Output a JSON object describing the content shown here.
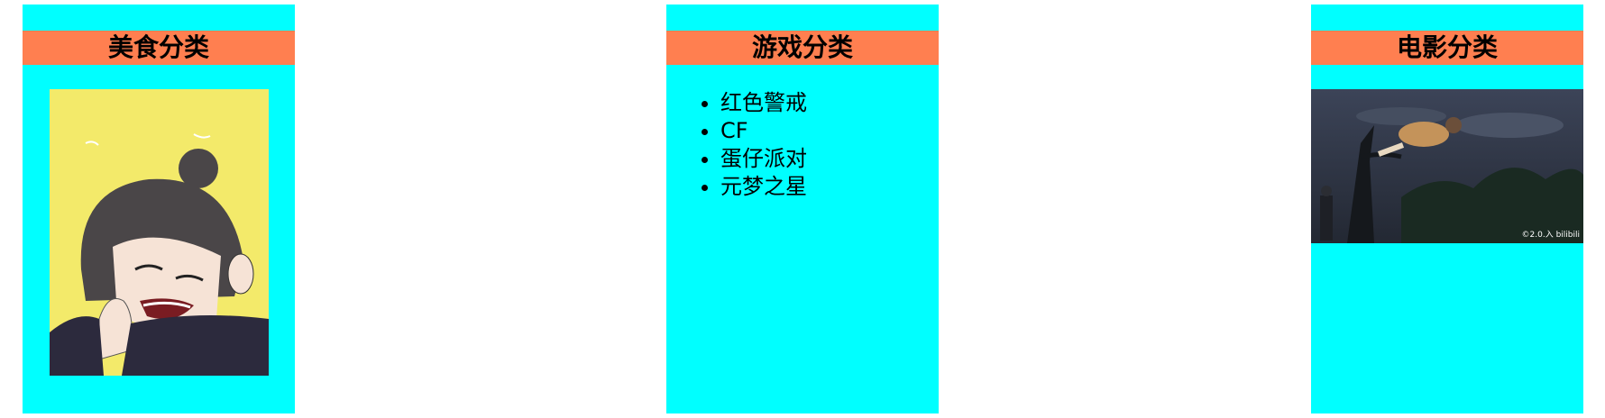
{
  "cards": {
    "food": {
      "title": "美食分类",
      "image_alt": "anime character crying with hands clasped"
    },
    "game": {
      "title": "游戏分类",
      "items": [
        "红色警戒",
        "CF",
        "蛋仔派对",
        "元梦之星"
      ]
    },
    "movie": {
      "title": "电影分类",
      "image_alt": "anime scene at night in forest",
      "watermark": "©2.0.入 bilibili"
    }
  },
  "colors": {
    "card_background": "#00ffff",
    "header_background": "#ff7f50",
    "page_background": "#ffffff"
  }
}
